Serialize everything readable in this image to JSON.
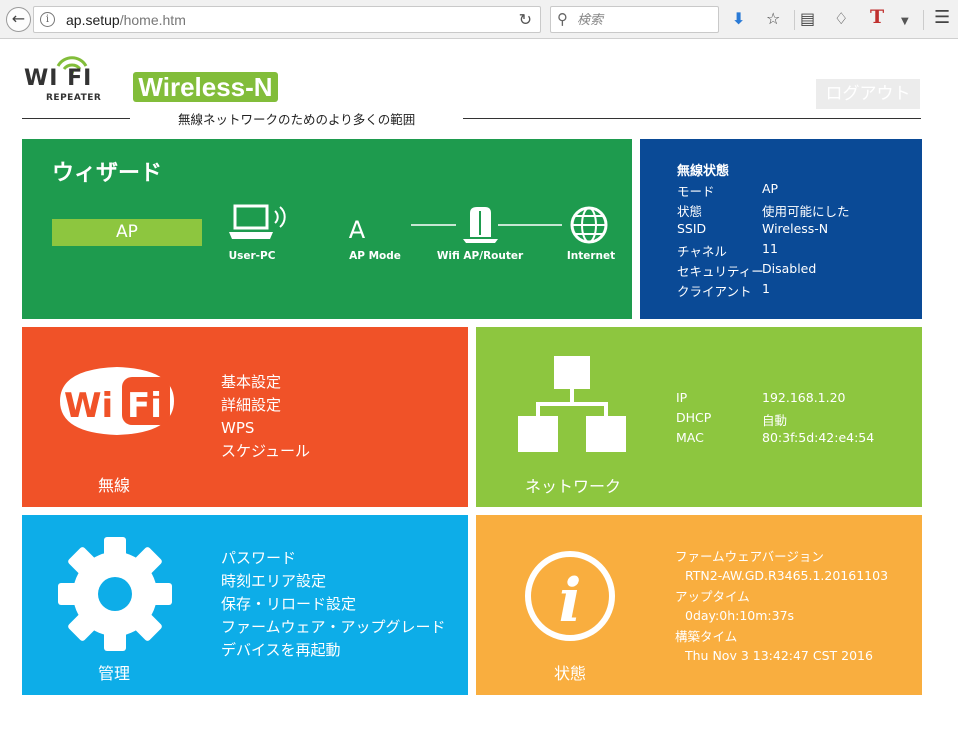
{
  "browser": {
    "url_host": "ap.setup",
    "url_path": "/home.htm",
    "search_placeholder": "検索",
    "t_icon_label": "T"
  },
  "header": {
    "logo_text": "WI  FI",
    "logo_subtitle": "REPEATER",
    "brand_badge": "Wireless-N",
    "logout_label": "ログアウト",
    "tagline": "無線ネットワークのためのより多くの範囲"
  },
  "wizard": {
    "title": "ウィザード",
    "mode_badge": "AP",
    "labels": {
      "user_pc": "User-PC",
      "ap_mode": "AP Mode",
      "ap_mode_glyph": "A",
      "router": "Wifi AP/Router",
      "internet": "Internet"
    }
  },
  "wireless_status": {
    "title": "無線状態",
    "rows": [
      {
        "label": "モード",
        "value": "AP"
      },
      {
        "label": "状態",
        "value": "使用可能にした"
      },
      {
        "label": "SSID",
        "value": "Wireless-N"
      },
      {
        "label": "チャネル",
        "value": "11"
      },
      {
        "label": "セキュリティー",
        "value": "Disabled"
      },
      {
        "label": "クライアント",
        "value": "1"
      }
    ]
  },
  "wireless": {
    "caption": "無線",
    "icon_text_wi": "Wi",
    "icon_text_fi": "Fi",
    "menu": [
      "基本設定",
      "詳細設定",
      "WPS",
      "スケジュール"
    ]
  },
  "network": {
    "caption": "ネットワーク",
    "rows": [
      {
        "label": "IP",
        "value": "192.168.1.20"
      },
      {
        "label": "DHCP",
        "value": "自動"
      },
      {
        "label": "MAC",
        "value": "80:3f:5d:42:e4:54"
      }
    ]
  },
  "admin": {
    "caption": "管理",
    "menu": [
      "パスワード",
      "時刻エリア設定",
      "保存・リロード設定",
      "ファームウェア・アップグレード",
      "デバイスを再起動"
    ]
  },
  "status": {
    "caption": "状態",
    "icon_glyph": "i",
    "firmware_label": "ファームウェアバージョン",
    "firmware_value": "RTN2-AW.GD.R3465.1.20161103",
    "uptime_label": "アップタイム",
    "uptime_value": "0day:0h:10m:37s",
    "build_label": "構築タイム",
    "build_value": "Thu Nov 3 13:42:47 CST 2016"
  },
  "colors": {
    "wizard": "#1e9b4e",
    "wireless_status": "#0a4a96",
    "wireless": "#f05228",
    "network": "#8dc63f",
    "admin": "#0dade8",
    "status": "#f9ae3f"
  }
}
